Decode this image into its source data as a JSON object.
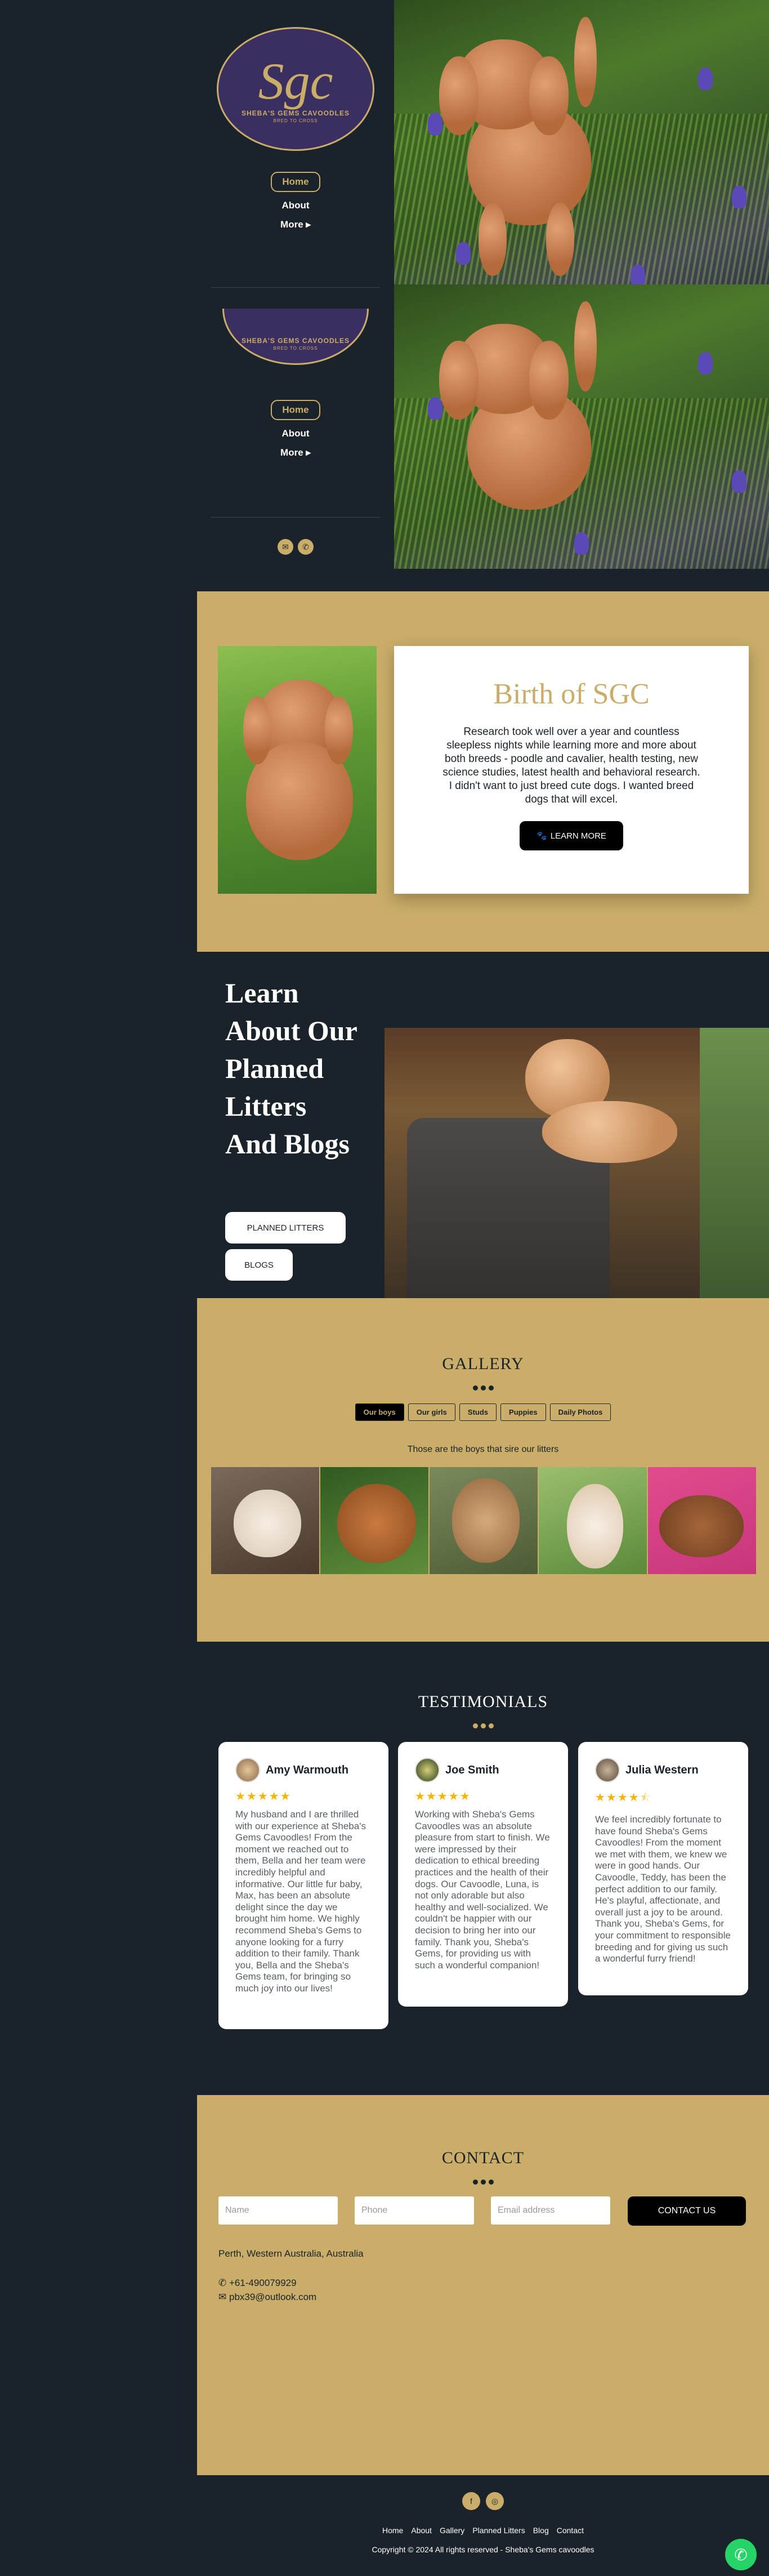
{
  "logo": {
    "monogram": "Sgc",
    "name": "SHEBA'S GEMS CAVOODLES",
    "tagline": "BRED TO CROSS"
  },
  "nav": {
    "home": "Home",
    "about": "About",
    "more": "More"
  },
  "header_icons": [
    "email-icon",
    "phone-icon"
  ],
  "birth": {
    "title": "Birth of SGC",
    "text": "Research took well over a year and countless sleepless nights while learning more and more about both breeds - poodle and cavalier, health testing, new science studies, latest health and behavioral research. I didn't want to just breed cute dogs. I wanted breed dogs that will excel.",
    "button": "LEARN MORE"
  },
  "learn": {
    "title": "Learn About Our Planned Litters And Blogs",
    "btn_litters": "PLANNED LITTERS",
    "btn_blogs": "BLOGS"
  },
  "gallery": {
    "title": "GALLERY",
    "tabs": [
      "Our boys",
      "Our girls",
      "Studs",
      "Puppies",
      "Daily Photos"
    ],
    "active_tab": "Our boys",
    "caption": "Those are the boys that sire our litters"
  },
  "testimonials": {
    "title": "TESTIMONIALS",
    "items": [
      {
        "name": "Amy Warmouth",
        "stars": 5,
        "text": "My husband and I are thrilled with our experience at Sheba's Gems Cavoodles! From the moment we reached out to them, Bella and her team were incredibly helpful and informative. Our little fur baby, Max, has been an absolute delight since the day we brought him home. We highly recommend Sheba's Gems to anyone looking for a furry addition to their family. Thank you, Bella and the Sheba's Gems team, for bringing so much joy into our lives!"
      },
      {
        "name": "Joe Smith",
        "stars": 5,
        "text": "Working with Sheba's Gems Cavoodles was an absolute pleasure from start to finish. We were impressed by their dedication to ethical breeding practices and the health of their dogs. Our Cavoodle, Luna, is not only adorable but also healthy and well-socialized. We couldn't be happier with our decision to bring her into our family. Thank you, Sheba's Gems, for providing us with such a wonderful companion!"
      },
      {
        "name": "Julia Western",
        "stars": 4.5,
        "text": "We feel incredibly fortunate to have found Sheba's Gems Cavoodles! From the moment we met with them, we knew we were in good hands. Our Cavoodle, Teddy, has been the perfect addition to our family. He's playful, affectionate, and overall just a joy to be around. Thank you, Sheba's Gems, for your commitment to responsible breeding and for giving us such a wonderful furry friend!"
      }
    ]
  },
  "contact": {
    "title": "CONTACT",
    "name_placeholder": "Name",
    "phone_placeholder": "Phone",
    "email_placeholder": "Email address",
    "button": "CONTACT US",
    "location": "Perth, Western Australia, Australia",
    "phone": "+61-490079929",
    "email": "pbx39@outlook.com"
  },
  "footer": {
    "links": [
      "Home",
      "About",
      "Gallery",
      "Planned Litters",
      "Blog",
      "Contact"
    ],
    "copyright": "Copyright © 2024 All rights reserved - Sheba's Gems cavoodles"
  },
  "colors": {
    "gold": "#c9ad68",
    "dark": "#1b232a",
    "purple": "#3b2f62",
    "whatsapp": "#25d366"
  }
}
